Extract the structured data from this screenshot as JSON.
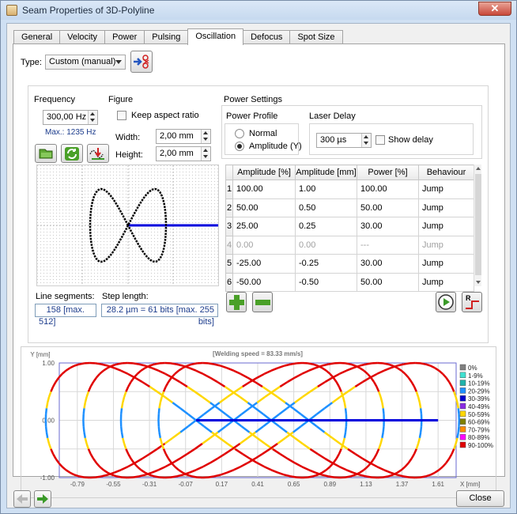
{
  "window": {
    "title": "Seam Properties of 3D-Polyline",
    "close_glyph": "✕"
  },
  "tabs": [
    "General",
    "Velocity",
    "Power",
    "Pulsing",
    "Oscillation",
    "Defocus",
    "Spot Size"
  ],
  "type": {
    "label": "Type:",
    "value": "Custom (manual)"
  },
  "frequency": {
    "label": "Frequency",
    "value": "300,00 Hz",
    "max": "Max.: 1235 Hz"
  },
  "figure": {
    "label": "Figure",
    "keep_aspect": "Keep aspect ratio",
    "width_label": "Width:",
    "width_value": "2,00 mm",
    "height_label": "Height:",
    "height_value": "2,00 mm"
  },
  "power_settings": {
    "label": "Power Settings",
    "profile_label": "Power Profile",
    "normal": "Normal",
    "amplitude": "Amplitude (Y)",
    "laser_delay_label": "Laser Delay",
    "laser_delay_value": "300 µs",
    "show_delay": "Show delay"
  },
  "table": {
    "headers": [
      "Amplitude [%]",
      "Amplitude [mm]",
      "Power [%]",
      "Behaviour"
    ],
    "rows": [
      {
        "n": "1",
        "amp_pct": "100.00",
        "amp_mm": "1.00",
        "power": "100.00",
        "behaviour": "Jump"
      },
      {
        "n": "2",
        "amp_pct": "50.00",
        "amp_mm": "0.50",
        "power": "50.00",
        "behaviour": "Jump"
      },
      {
        "n": "3",
        "amp_pct": "25.00",
        "amp_mm": "0.25",
        "power": "30.00",
        "behaviour": "Jump"
      },
      {
        "n": "4",
        "amp_pct": "0.00",
        "amp_mm": "0.00",
        "power": "---",
        "behaviour": "Jump"
      },
      {
        "n": "5",
        "amp_pct": "-25.00",
        "amp_mm": "-0.25",
        "power": "30.00",
        "behaviour": "Jump"
      },
      {
        "n": "6",
        "amp_pct": "-50.00",
        "amp_mm": "-0.50",
        "power": "50.00",
        "behaviour": "Jump"
      }
    ]
  },
  "line_segments": {
    "label": "Line segments:",
    "value": "158",
    "max": "[max. 512]"
  },
  "step_length": {
    "label": "Step length:",
    "value": "28.2 µm = 61 bits",
    "max": "[max. 255 bits]"
  },
  "chart": {
    "welding_speed": "[Welding speed = 83.33 mm/s]",
    "y_label": "Y [mm]",
    "x_label": "X [mm]",
    "y_ticks": [
      "1.00",
      "0.00",
      "-1.00"
    ],
    "x_ticks": [
      "-0.79",
      "-0.55",
      "-0.31",
      "-0.07",
      "0.17",
      "0.41",
      "0.65",
      "0.89",
      "1.13",
      "1.37",
      "1.61"
    ],
    "legend": [
      {
        "label": "0%",
        "color": "#808080"
      },
      {
        "label": "1-9%",
        "color": "#40e0d0"
      },
      {
        "label": "10-19%",
        "color": "#20b2aa"
      },
      {
        "label": "20-29%",
        "color": "#1e90ff"
      },
      {
        "label": "30-39%",
        "color": "#0000cd"
      },
      {
        "label": "40-49%",
        "color": "#8a2be2"
      },
      {
        "label": "50-59%",
        "color": "#ffd700"
      },
      {
        "label": "60-69%",
        "color": "#808000"
      },
      {
        "label": "70-79%",
        "color": "#ff8c00"
      },
      {
        "label": "80-89%",
        "color": "#ff00ff"
      },
      {
        "label": "90-100%",
        "color": "#e00000"
      }
    ]
  },
  "chart_data": {
    "type": "line",
    "title": "[Welding speed = 83.33 mm/s]",
    "xlabel": "X [mm]",
    "ylabel": "Y [mm]",
    "xlim": [
      -0.91,
      1.73
    ],
    "ylim": [
      -1.0,
      1.0
    ],
    "x_ticks": [
      -0.79,
      -0.55,
      -0.31,
      -0.07,
      0.17,
      0.41,
      0.65,
      0.89,
      1.13,
      1.37,
      1.61
    ],
    "y_ticks": [
      -1.0,
      0.0,
      1.0
    ],
    "pattern": "figure-eight",
    "pattern_width_mm": 2.0,
    "pattern_height_mm": 2.0,
    "center_x_start_mm": 0.0,
    "center_x_end_mm": 0.75,
    "line_end_x_mm": 1.61,
    "series": [
      {
        "name": "90-100%",
        "color": "#e00000"
      },
      {
        "name": "50-59%",
        "color": "#ffd700"
      },
      {
        "name": "30-39%",
        "color": "#0000cd"
      },
      {
        "name": "20-29%",
        "color": "#1e90ff"
      }
    ],
    "grid": true
  },
  "footer": {
    "close": "Close"
  },
  "colors": {
    "accent_red": "#cc2020",
    "line_blue": "#0000dd",
    "chart_border": "#6a6ad0"
  }
}
